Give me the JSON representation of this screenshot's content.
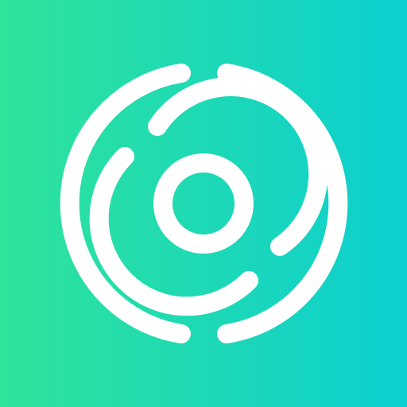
{
  "app_icon": {
    "icon_name": "concentric-rings-logo-icon",
    "colors": {
      "gradient_start": "#2fe39a",
      "gradient_end": "#0ccfd0",
      "foreground": "#ffffff"
    }
  }
}
